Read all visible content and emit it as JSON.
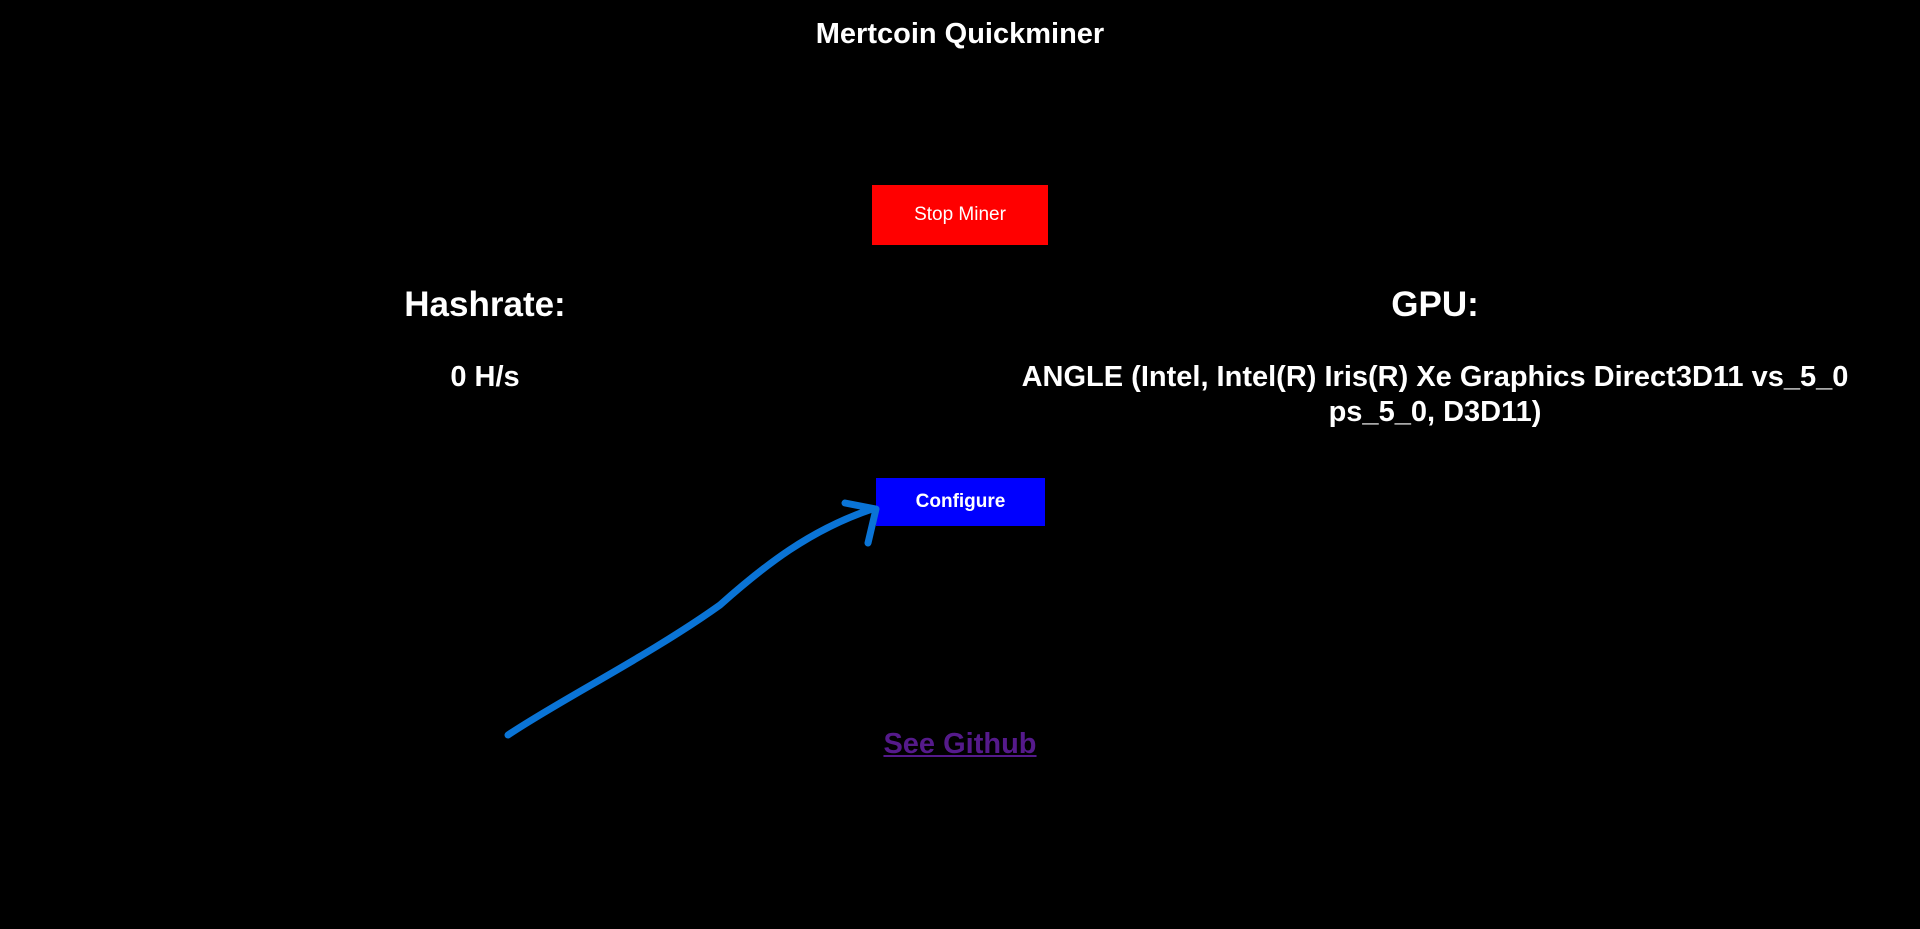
{
  "app": {
    "title": "Mertcoin Quickminer"
  },
  "controls": {
    "stop_label": "Stop Miner",
    "configure_label": "Configure"
  },
  "stats": {
    "hashrate_heading": "Hashrate:",
    "hashrate_value": "0 H/s",
    "gpu_heading": "GPU:",
    "gpu_value": "ANGLE (Intel, Intel(R) Iris(R) Xe Graphics Direct3D11 vs_5_0 ps_5_0, D3D11)"
  },
  "footer": {
    "github_label": "See Github"
  },
  "colors": {
    "background": "#000000",
    "stop_button": "#ff0000",
    "configure_button": "#0000ff",
    "link_visited": "#551a8b",
    "annotation_arrow": "#0a74d6"
  }
}
